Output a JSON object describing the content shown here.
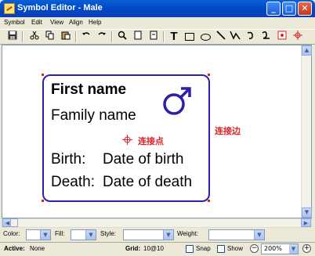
{
  "window": {
    "title": "Symbol Editor - Male",
    "min_glyph": "_",
    "max_glyph": "□",
    "close_glyph": "✕"
  },
  "menu": {
    "items": [
      "Symbol",
      "Edit",
      "View",
      "Align",
      "Help"
    ]
  },
  "toolbar": {
    "buttons": [
      "save-icon",
      "cut-icon",
      "copy-icon",
      "paste-icon",
      "undo-icon",
      "redo-icon",
      "zoom-icon",
      "page-icon",
      "page-fit-icon",
      "text-tool-icon",
      "rectangle-tool-icon",
      "ellipse-tool-icon",
      "line-tool-icon",
      "polyline-tool-icon",
      "arc-tool-icon",
      "curve-tool-icon",
      "image-tool-icon",
      "connection-point-icon"
    ],
    "text_tool_glyph": "T"
  },
  "symbol": {
    "first_name": "First name",
    "family_name": "Family name",
    "birth_label": "Birth:",
    "birth_value": "Date of birth",
    "death_label": "Death:",
    "death_value": "Date of death",
    "gender_icon": "male-icon",
    "border_color": "#2c1fa8"
  },
  "annotations": {
    "connection_point": "连接点",
    "connection_edge": "连接边",
    "color": "#d7262a"
  },
  "properties": {
    "color_label": "Color:",
    "fill_label": "Fill:",
    "style_label": "Style:",
    "weight_label": "Weight:"
  },
  "status": {
    "active_label": "Active:",
    "active_value": "None",
    "grid_label": "Grid:",
    "grid_value": "10@10",
    "snap_label": "Snap",
    "show_label": "Show",
    "zoom_value": "200%"
  }
}
